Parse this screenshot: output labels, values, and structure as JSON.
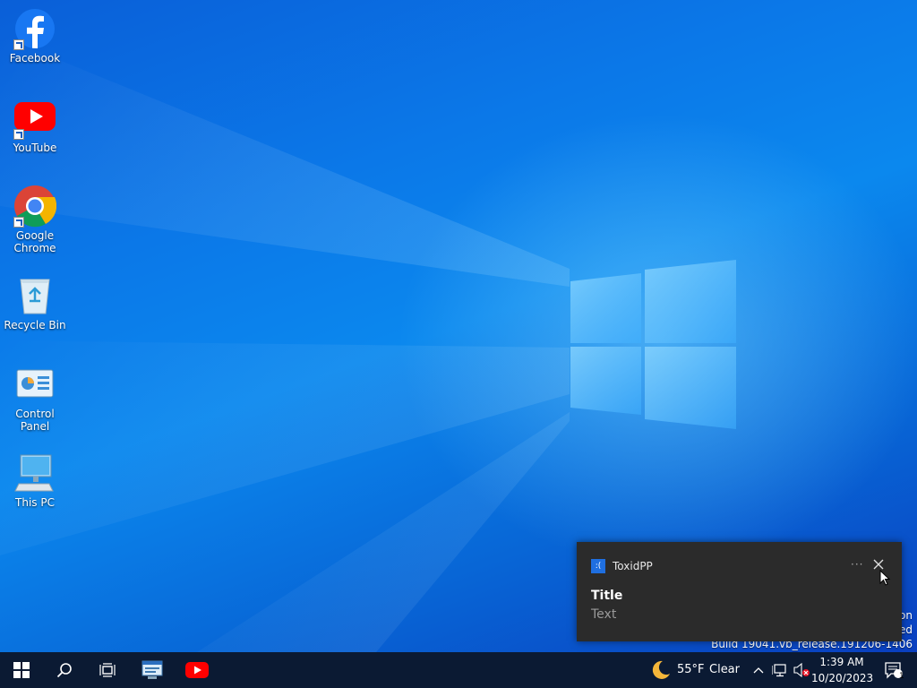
{
  "desktop": {
    "icons": [
      {
        "label": "Facebook"
      },
      {
        "label": "YouTube"
      },
      {
        "label": "Google Chrome"
      },
      {
        "label": "Recycle Bin"
      },
      {
        "label": "Control Panel"
      },
      {
        "label": "This PC"
      }
    ],
    "build_info": {
      "line1": "on",
      "line2": "ed",
      "line3": "Build 19041.vb_release.191206-1406"
    }
  },
  "notification": {
    "app_icon_glyph": ":(",
    "app_name": "ToxidPP",
    "more_label": "···",
    "title": "Title",
    "text": "Text"
  },
  "taskbar": {
    "weather": {
      "temp": "55°F",
      "condition": "Clear",
      "icon": "moon-icon"
    },
    "clock": {
      "time": "1:39 AM",
      "date": "10/20/2023"
    },
    "notification_count": "1"
  },
  "colors": {
    "taskbar": "#0b1a33",
    "toast_bg": "#2b2b2b",
    "accent": "#1f6fe0"
  }
}
